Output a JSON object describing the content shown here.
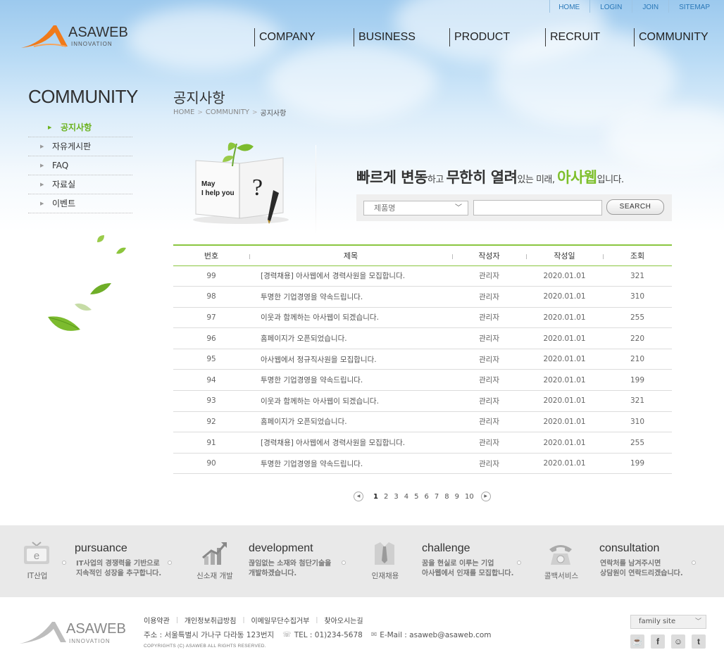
{
  "util_links": [
    "HOME",
    "LOGIN",
    "JOIN",
    "SITEMAP"
  ],
  "logo": {
    "brand": "ASAWEB",
    "sub": "INNOVATION"
  },
  "gnb": [
    "COMPANY",
    "BUSINESS",
    "PRODUCT",
    "RECRUIT",
    "COMMUNITY"
  ],
  "sidebar": {
    "title": "COMMUNITY",
    "items": [
      {
        "label": "공지사항",
        "active": true
      },
      {
        "label": "자유게시판",
        "active": false
      },
      {
        "label": "FAQ",
        "active": false
      },
      {
        "label": "자료실",
        "active": false
      },
      {
        "label": "이벤트",
        "active": false
      }
    ]
  },
  "page": {
    "title": "공지사항",
    "breadcrumb": [
      "HOME",
      "COMMUNITY",
      "공지사항"
    ]
  },
  "visual": {
    "book_text_1": "May",
    "book_text_2": "I help you",
    "book_mark": "?",
    "slogan": {
      "b1": "빠르게 변동",
      "t1": "하고 ",
      "b2": "무한히 열려",
      "t2": "있는 미래, ",
      "b3": "아사웹",
      "t3": "입니다."
    }
  },
  "search": {
    "select_value": "제품명",
    "input_value": "",
    "button_label": "SEARCH"
  },
  "board": {
    "columns": [
      "번호",
      "제목",
      "작성자",
      "작성일",
      "조회"
    ],
    "rows": [
      [
        "99",
        "[경력채용] 아사웹에서 경력사원을 모집합니다.",
        "관리자",
        "2020.01.01",
        "321"
      ],
      [
        "98",
        "투명한 기업경영을 약속드립니다.",
        "관리자",
        "2020.01.01",
        "310"
      ],
      [
        "97",
        "이웃과 함께하는 아사웹이 되겠습니다.",
        "관리자",
        "2020.01.01",
        "255"
      ],
      [
        "96",
        "홈페이지가 오픈되었습니다.",
        "관리자",
        "2020.01.01",
        "220"
      ],
      [
        "95",
        "아사웹에서 정규직사원을 모집합니다.",
        "관리자",
        "2020.01.01",
        "210"
      ],
      [
        "94",
        "투명한 기업경영을 약속드립니다.",
        "관리자",
        "2020.01.01",
        "199"
      ],
      [
        "93",
        "이웃과 함께하는 아사웹이 되겠습니다.",
        "관리자",
        "2020.01.01",
        "321"
      ],
      [
        "92",
        "홈페이지가 오픈되었습니다.",
        "관리자",
        "2020.01.01",
        "310"
      ],
      [
        "91",
        "[경력채용] 아사웹에서 경력사원을 모집합니다.",
        "관리자",
        "2020.01.01",
        "255"
      ],
      [
        "90",
        "투명한 기업경영을 약속드립니다.",
        "관리자",
        "2020.01.01",
        "199"
      ]
    ]
  },
  "paging": {
    "pages": [
      "1",
      "2",
      "3",
      "4",
      "5",
      "6",
      "7",
      "8",
      "9",
      "10"
    ],
    "current": "1",
    "prev": "◀",
    "next": "▶"
  },
  "services": [
    {
      "icon": "tv-e-icon",
      "label": "IT산업",
      "title": "pursuance",
      "lines": [
        "IT사업의 경쟁력을 기반으로",
        "지속적인 성장을 추구합니다."
      ]
    },
    {
      "icon": "growth-chart-icon",
      "label": "신소재 개발",
      "title": "development",
      "lines": [
        "끊임없는 소재와 첨단기술을",
        "개발하겠습니다."
      ]
    },
    {
      "icon": "shirt-tie-icon",
      "label": "인재채용",
      "title": "challenge",
      "lines": [
        "꿈을 현실로 이루는 기업",
        "아사웹에서 인재를 모집합니다."
      ]
    },
    {
      "icon": "telephone-icon",
      "label": "콜백서비스",
      "title": "consultation",
      "lines": [
        "연락처를 남겨주시면",
        "상담원이 연락드리겠습니다."
      ]
    }
  ],
  "footer": {
    "links": [
      "이용약관",
      "개인정보취급방침",
      "이메일무단수집거부",
      "찾아오시는길"
    ],
    "address": "주소 : 서울특별시 가나구 다라동 123번지",
    "tel": "TEL : 01)234-5678",
    "email": "E-Mail : asaweb@asaweb.com",
    "copyright": "COPYRIGHTS (C) ASAWEB ALL RIGHTS RESERVED.",
    "family_site": "family site",
    "social": [
      "cafe-icon",
      "facebook-icon",
      "talk-icon",
      "twitter-icon"
    ]
  },
  "colors": {
    "accent_green": "#7dbf2a",
    "link_blue": "#2a78b8",
    "logo_orange": "#f07a1a"
  }
}
